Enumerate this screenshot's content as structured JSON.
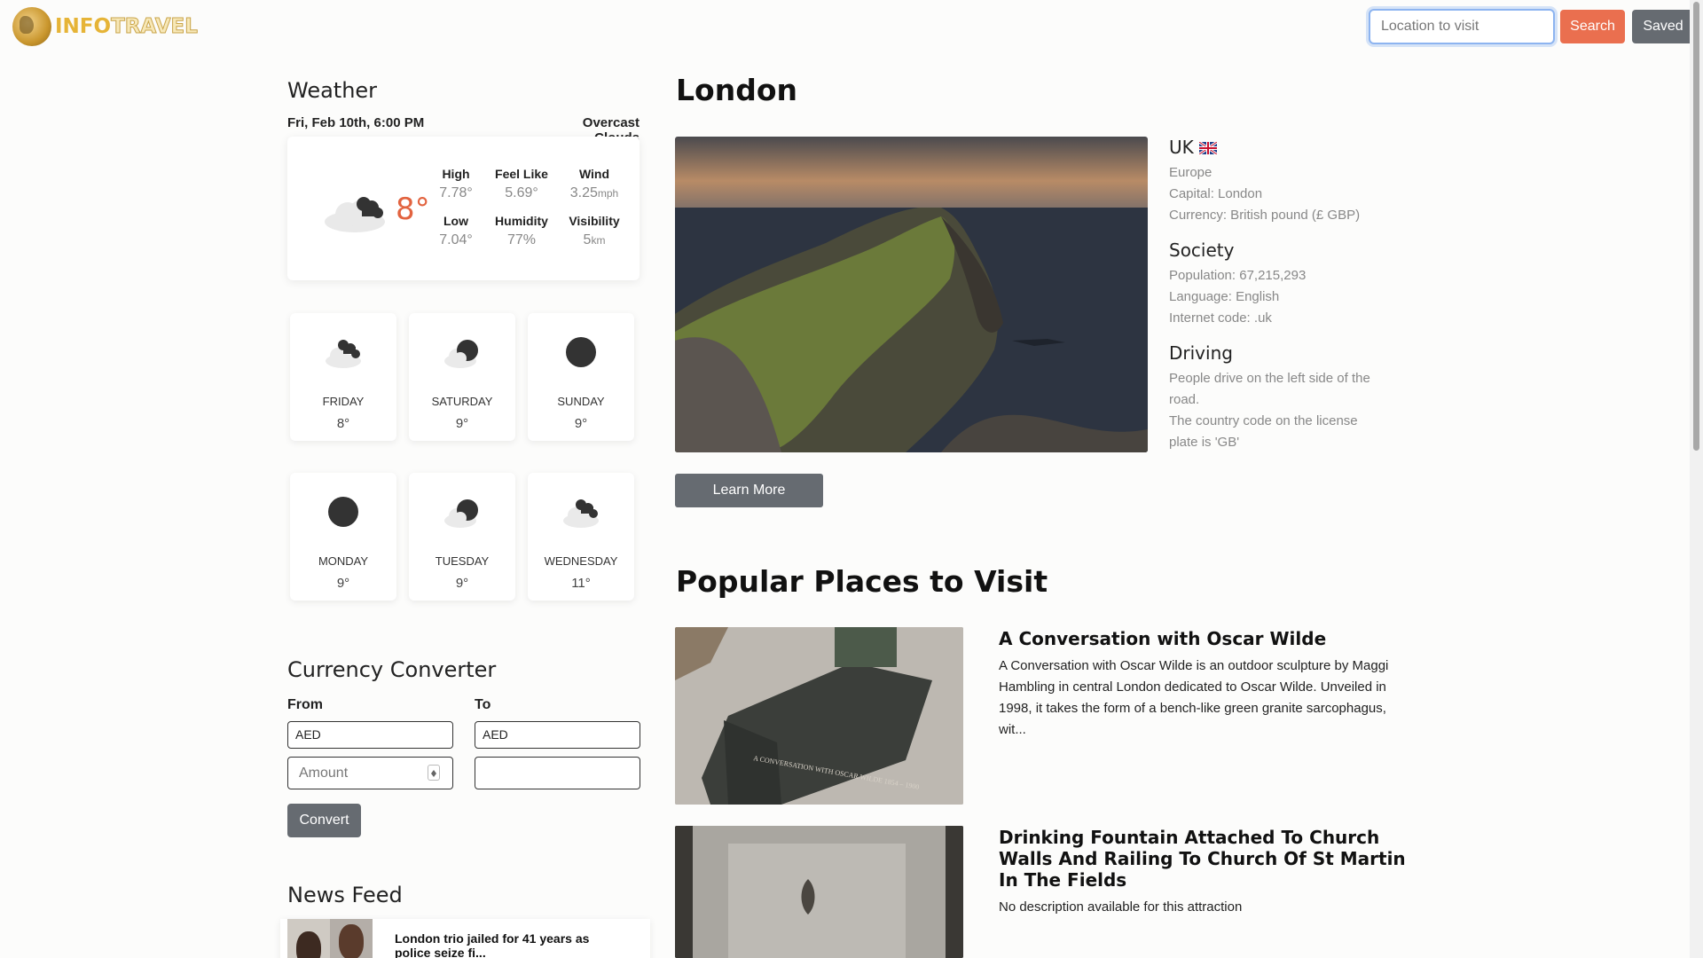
{
  "header": {
    "logo_part1": "INFO",
    "logo_part2": "TRAVEL",
    "search_placeholder": "Location to visit",
    "search_button": "Search",
    "saved_button": "Saved"
  },
  "weather": {
    "title": "Weather",
    "datetime": "Fri, Feb 10th, 6:00 PM",
    "condition": "Overcast Clouds",
    "current_temp": "8°",
    "stats": {
      "high_label": "High",
      "high_value": "7.78°",
      "feel_label": "Feel Like",
      "feel_value": "5.69°",
      "wind_label": "Wind",
      "wind_value": "3.25",
      "wind_unit": "mph",
      "low_label": "Low",
      "low_value": "7.04°",
      "humidity_label": "Humidity",
      "humidity_value": "77%",
      "visibility_label": "Visibility",
      "visibility_value": "5",
      "visibility_unit": "km"
    },
    "forecast": [
      {
        "day": "FRIDAY",
        "temp": "8°",
        "icon": "clouds-icon"
      },
      {
        "day": "SATURDAY",
        "temp": "9°",
        "icon": "cloud-moon-icon"
      },
      {
        "day": "SUNDAY",
        "temp": "9°",
        "icon": "moon-icon"
      },
      {
        "day": "MONDAY",
        "temp": "9°",
        "icon": "moon-icon"
      },
      {
        "day": "TUESDAY",
        "temp": "9°",
        "icon": "cloud-moon-icon"
      },
      {
        "day": "WEDNESDAY",
        "temp": "11°",
        "icon": "clouds-icon"
      }
    ]
  },
  "currency": {
    "title": "Currency Converter",
    "from_label": "From",
    "to_label": "To",
    "from_value": "AED",
    "to_value": "AED",
    "amount_placeholder": "Amount",
    "convert_button": "Convert"
  },
  "news": {
    "title": "News Feed",
    "items": [
      {
        "headline": "London trio jailed for 41 years as police seize fi..."
      }
    ]
  },
  "city": {
    "name": "London",
    "learn_more": "Learn More",
    "country": {
      "name": "UK",
      "region": "Europe",
      "capital": "Capital: London",
      "currency": "Currency: British pound (£ GBP)"
    },
    "society": {
      "heading": "Society",
      "population": "Population: 67,215,293",
      "language": "Language: English",
      "internet": "Internet code: .uk"
    },
    "driving": {
      "heading": "Driving",
      "side": "People drive on the left side of the road.",
      "plate": "The country code on the license plate is 'GB'"
    }
  },
  "places": {
    "title": "Popular Places to Visit",
    "items": [
      {
        "name": "A Conversation with Oscar Wilde",
        "description": "A Conversation with Oscar Wilde is an outdoor sculpture by Maggi Hambling in central London dedicated to Oscar Wilde. Unveiled in 1998, it takes the form of a bench-like green granite sarcophagus, wit...",
        "image_inscription": "A CONVERSATION WITH OSCAR WILDE 1854 – 1900"
      },
      {
        "name": "Drinking Fountain Attached To Church Walls And Railing To Church Of St Martin In The Fields",
        "description": "No description available for this attraction"
      }
    ]
  },
  "colors": {
    "accent": "#ea6f4f",
    "button_gray": "#666b71",
    "temp_orange": "#e2633f",
    "logo_gold": "#e6b437"
  }
}
